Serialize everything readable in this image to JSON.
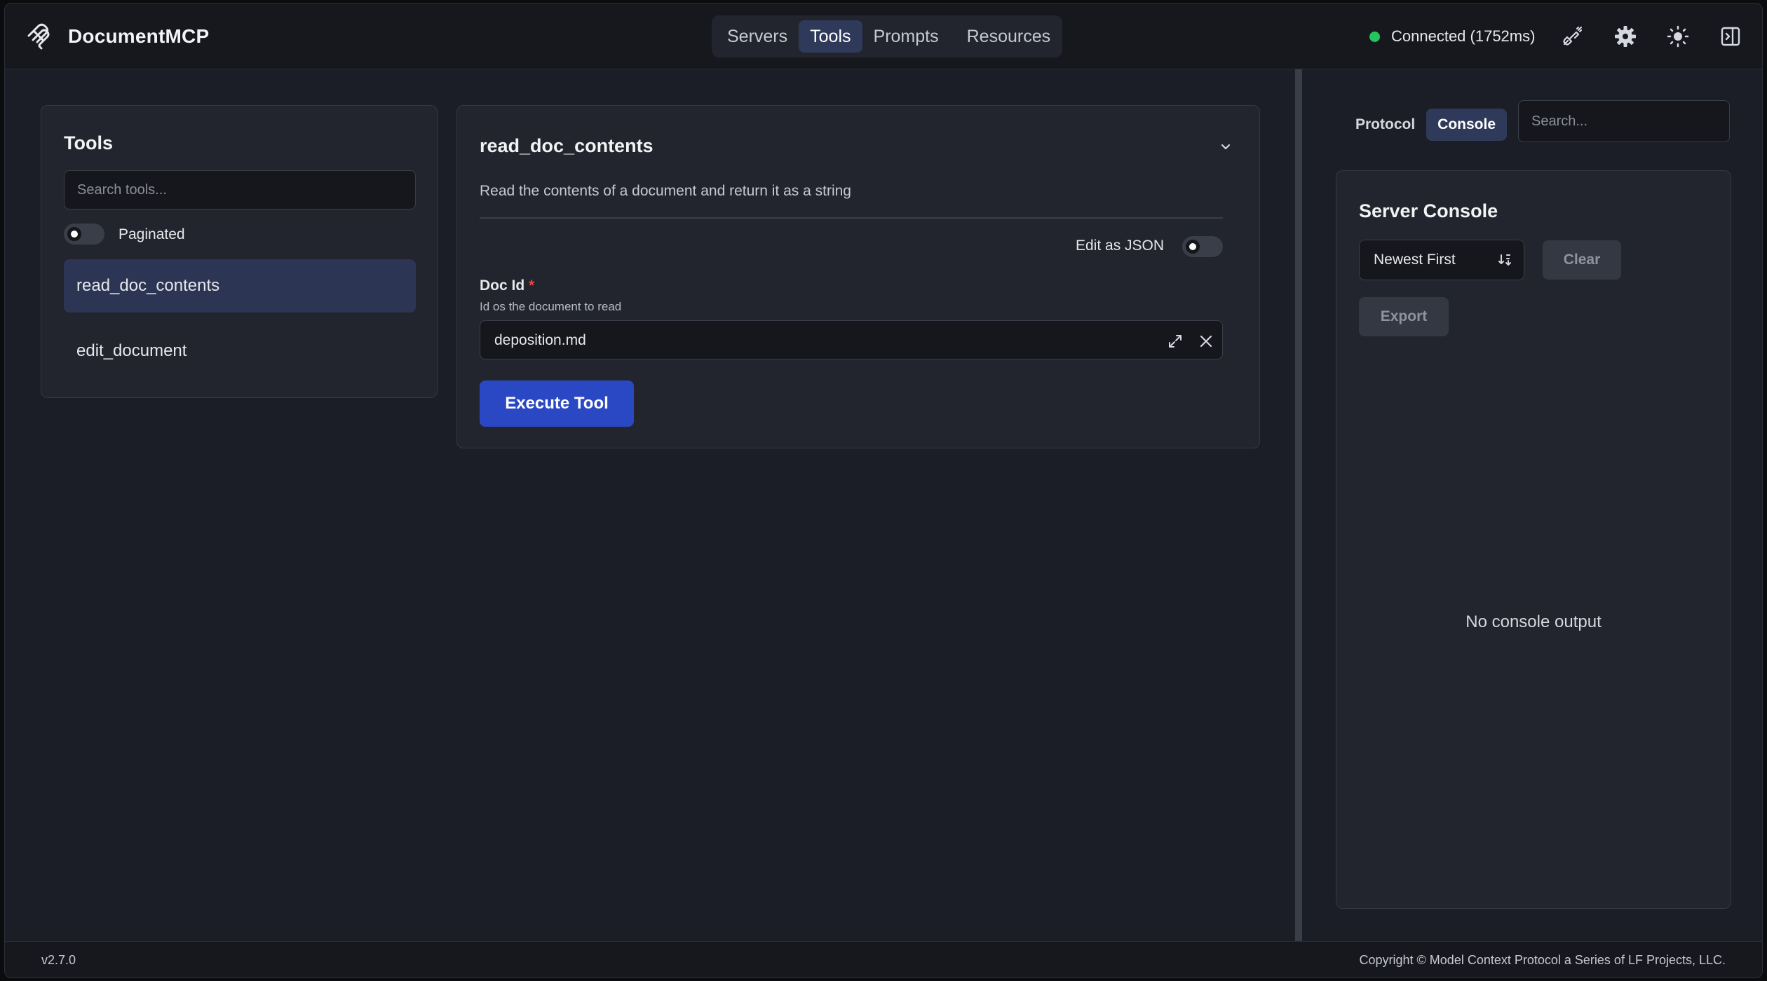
{
  "header": {
    "app_name": "DocumentMCP",
    "nav": [
      "Servers",
      "Tools",
      "Prompts",
      "Resources"
    ],
    "active_nav": "Tools",
    "status_text": "Connected (1752ms)",
    "status_color": "#22c55e",
    "icons": [
      "plug-icon",
      "gear-icon",
      "sun-icon",
      "panel-toggle-icon"
    ]
  },
  "tools_panel": {
    "title": "Tools",
    "search_placeholder": "Search tools...",
    "paginated_label": "Paginated",
    "items": [
      {
        "label": "read_doc_contents",
        "selected": true
      },
      {
        "label": "edit_document",
        "selected": false
      }
    ]
  },
  "tool_detail": {
    "title": "read_doc_contents",
    "description": "Read the contents of a document and return it as a string",
    "edit_json_label": "Edit as JSON",
    "field": {
      "label": "Doc Id",
      "required_mark": "*",
      "help": "Id os the document to read",
      "value": "deposition.md"
    },
    "execute_label": "Execute Tool"
  },
  "right_panel": {
    "tabs": [
      "Protocol",
      "Console"
    ],
    "active_tab": "Console",
    "search_placeholder": "Search...",
    "console": {
      "title": "Server Console",
      "sort_value": "Newest First",
      "clear_label": "Clear",
      "export_label": "Export",
      "empty_text": "No console output"
    }
  },
  "footer": {
    "version": "v2.7.0",
    "copyright": "Copyright © Model Context Protocol a Series of LF Projects, LLC."
  }
}
